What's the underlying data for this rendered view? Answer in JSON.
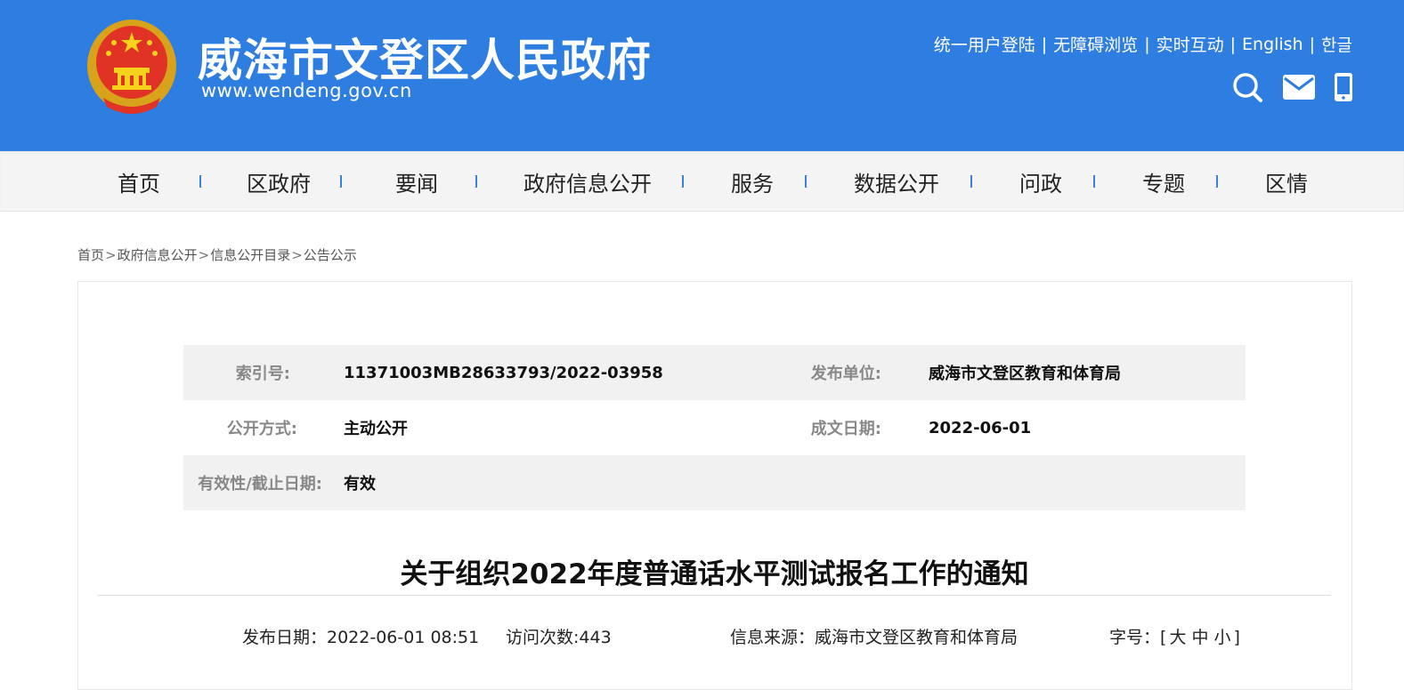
{
  "header": {
    "title": "威海市文登区人民政府",
    "url": "www.wendeng.gov.cn",
    "links": [
      "统一用户登陆",
      "无障碍浏览",
      "实时互动",
      "English",
      "한글"
    ],
    "icons": [
      "search-icon",
      "mail-icon",
      "mobile-icon"
    ],
    "bg_color": "#2e7de0"
  },
  "nav": {
    "items": [
      "首页",
      "区政府",
      "要闻",
      "政府信息公开",
      "服务",
      "数据公开",
      "问政",
      "专题",
      "区情"
    ],
    "divider_color": "#3a7fd8"
  },
  "breadcrumb": {
    "items": [
      "首页",
      "政府信息公开",
      "信息公开目录",
      "公告公示"
    ],
    "separator": ">"
  },
  "meta": {
    "index_label": "索引号:",
    "index_value": "11371003MB28633793/2022-03958",
    "publisher_label": "发布单位:",
    "publisher_value": "威海市文登区教育和体育局",
    "mode_label": "公开方式:",
    "mode_value": "主动公开",
    "date_label": "成文日期:",
    "date_value": "2022-06-01",
    "validity_label": "有效性/截止日期:",
    "validity_value": "有效"
  },
  "article": {
    "title": "关于组织2022年度普通话水平测试报名工作的通知",
    "publish_date": "发布日期：2022-06-01 08:51",
    "visits": "访问次数:443",
    "source": "信息来源：威海市文登区教育和体育局",
    "font_size_label": "字号：",
    "font_size_large": "大",
    "font_size_medium": "中",
    "font_size_small": "小"
  }
}
